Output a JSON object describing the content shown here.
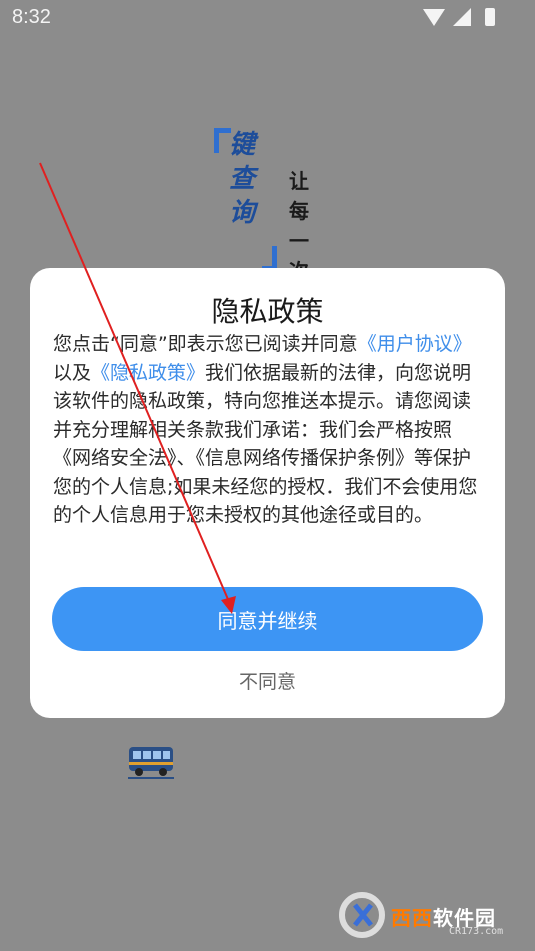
{
  "status_bar": {
    "time": "8:32"
  },
  "background": {
    "slogan_main": [
      "键",
      "查",
      "询"
    ],
    "slogan_sub": [
      "让",
      "每",
      "一",
      "次"
    ]
  },
  "dialog": {
    "title": "隐私政策",
    "body": {
      "p1": "您点击“同意”即表示您已阅读并同意",
      "link_user_agreement": "《用户协议》",
      "p2": "以及",
      "link_privacy_policy": "《隐私政策》",
      "p3": "我们依据最新的法律，向您说明该软件的隐私政策，特向您推送本提示。请您阅读并充分理解相关条款我们承诺：我们会严格按照《网络安全法》、《信息网络传播保护条例》等保护您的个人信息;如果未经您的授权．我们不会使用您的个人信息用于您未授权的其他途径或目的。"
    },
    "agree_label": "同意并继续",
    "decline_label": "不同意"
  },
  "watermark": {
    "brand_colored": "西西",
    "brand_plain": "软件园",
    "site": "CR173.com"
  },
  "colors": {
    "accent": "#3d95f4",
    "link": "#3f8eea",
    "annotation_arrow": "#e02020",
    "overlay": "#8c8c8c"
  }
}
